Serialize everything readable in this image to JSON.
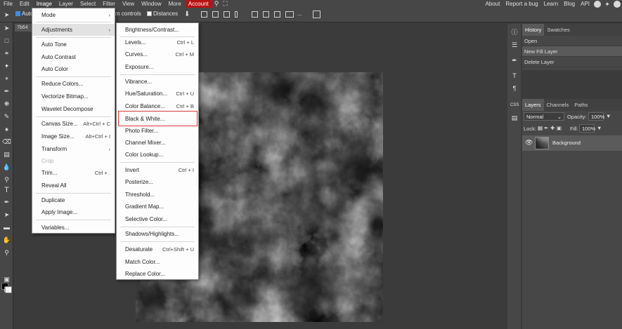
{
  "menubar": {
    "items": [
      "File",
      "Edit",
      "Image",
      "Layer",
      "Select",
      "Filter",
      "View",
      "Window",
      "More",
      "Account"
    ],
    "right_items": [
      "About",
      "Report a bug",
      "Learn",
      "Blog",
      "API"
    ]
  },
  "options_bar": {
    "auto_select_label": "Auto",
    "transform_controls_label": "m controls",
    "distances_label": "Distances"
  },
  "document_tab": {
    "name": "7b64"
  },
  "image_menu": {
    "items": [
      {
        "label": "Mode",
        "arrow": "›"
      },
      {
        "label": "Adjustments",
        "arrow": "›"
      },
      {
        "label": "Auto Tone"
      },
      {
        "label": "Auto Contrast"
      },
      {
        "label": "Auto Color"
      },
      {
        "label": "Reduce Colors..."
      },
      {
        "label": "Vectorize Bitmap..."
      },
      {
        "label": "Wavelet Decompose"
      },
      {
        "label": "Canvas Size...",
        "shortcut": "Alt+Ctrl + C"
      },
      {
        "label": "Image Size...",
        "shortcut": "Alt+Ctrl + I"
      },
      {
        "label": "Transform",
        "arrow": "›"
      },
      {
        "label": "Crop"
      },
      {
        "label": "Trim...",
        "shortcut": "Ctrl + ."
      },
      {
        "label": "Reveal All"
      },
      {
        "label": "Duplicate"
      },
      {
        "label": "Apply Image..."
      },
      {
        "label": "Variables..."
      }
    ]
  },
  "adjustments_menu": {
    "items": [
      {
        "label": "Brightness/Contrast..."
      },
      {
        "label": "Levels...",
        "shortcut": "Ctrl + L"
      },
      {
        "label": "Curves...",
        "shortcut": "Ctrl + M"
      },
      {
        "label": "Exposure..."
      },
      {
        "label": "Vibrance..."
      },
      {
        "label": "Hue/Saturation...",
        "shortcut": "Ctrl + U"
      },
      {
        "label": "Color Balance...",
        "shortcut": "Ctrl + B"
      },
      {
        "label": "Black & White..."
      },
      {
        "label": "Photo Filter..."
      },
      {
        "label": "Channel Mixer..."
      },
      {
        "label": "Color Lookup..."
      },
      {
        "label": "Invert",
        "shortcut": "Ctrl + I"
      },
      {
        "label": "Posterize..."
      },
      {
        "label": "Threshold..."
      },
      {
        "label": "Gradient Map..."
      },
      {
        "label": "Selective Color..."
      },
      {
        "label": "Shadows/Highlights..."
      },
      {
        "label": "Desaturate",
        "shortcut": "Ctrl+Shift + U"
      },
      {
        "label": "Match Color..."
      },
      {
        "label": "Replace Color..."
      }
    ]
  },
  "history_panel": {
    "tabs": [
      "History",
      "Swatches"
    ],
    "rows": [
      "Open",
      "New Fill Layer",
      "Delete Layer"
    ]
  },
  "layers_panel": {
    "tabs": [
      "Layers",
      "Channels",
      "Paths"
    ],
    "blend_mode": "Normal",
    "opacity_label": "Opacity:",
    "opacity_value": "100%",
    "lock_label": "Lock:",
    "fill_label": "Fill:",
    "fill_value": "100%",
    "layer_name": "Background"
  },
  "colors": {
    "account_button": "#b71313",
    "highlight_box": "#d43b3b",
    "menu_bg": "#fdfdfd",
    "app_bg": "#3b3b3b"
  }
}
